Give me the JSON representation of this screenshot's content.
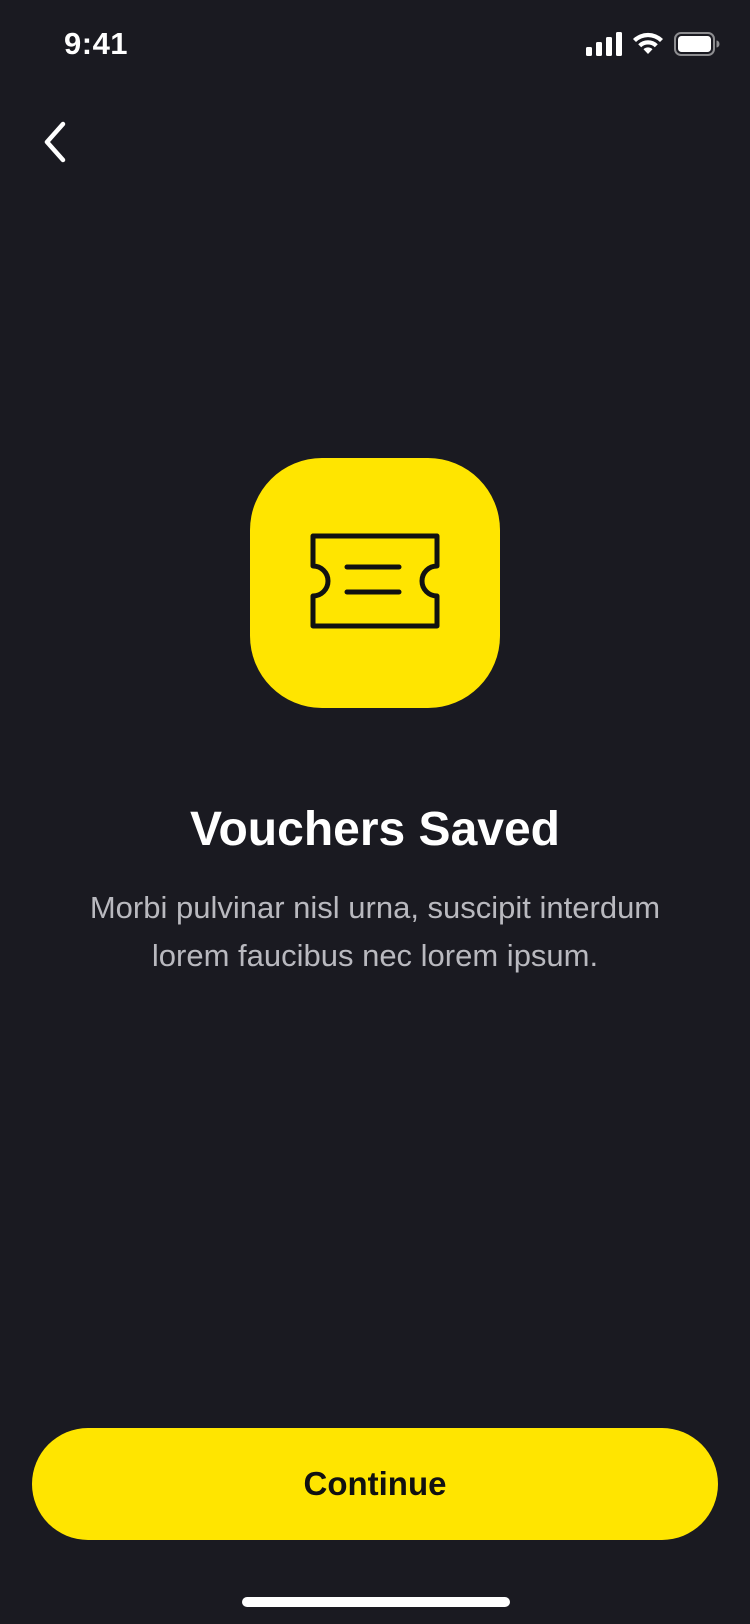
{
  "status_bar": {
    "time": "9:41"
  },
  "icons": {
    "back": "chevron-left-icon",
    "hero": "ticket-icon",
    "signal": "cellular-signal-icon",
    "wifi": "wifi-icon",
    "battery": "battery-icon"
  },
  "content": {
    "title": "Vouchers Saved",
    "description": "Morbi pulvinar nisl urna, suscipit interdum lorem faucibus nec lorem ipsum."
  },
  "actions": {
    "continue_label": "Continue"
  },
  "colors": {
    "background": "#1A1A21",
    "accent": "#FFE500",
    "text_primary": "#FFFFFF",
    "text_secondary": "#B9B9BF"
  }
}
